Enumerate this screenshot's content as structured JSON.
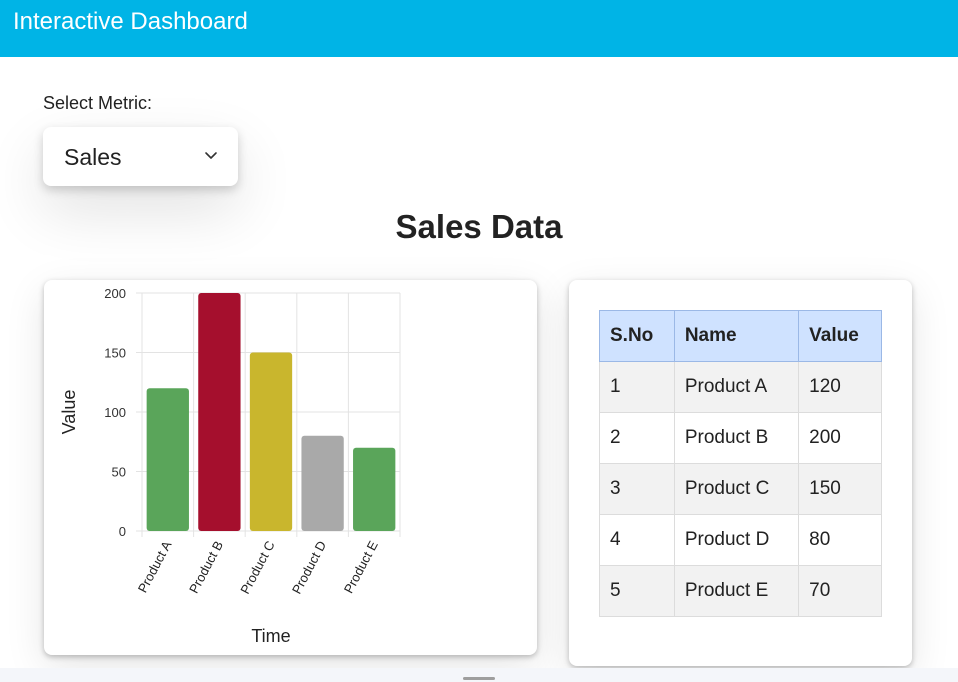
{
  "header": {
    "title": "Interactive Dashboard"
  },
  "selector": {
    "label": "Select Metric:",
    "value": "Sales",
    "icon": "chevron-down-icon"
  },
  "section": {
    "title": "Sales Data"
  },
  "chart_data": {
    "type": "bar",
    "categories": [
      "Product A",
      "Product B",
      "Product C",
      "Product D",
      "Product E"
    ],
    "values": [
      120,
      200,
      150,
      80,
      70
    ],
    "colors": [
      "#5aa55a",
      "#a50f2d",
      "#c9b62d",
      "#a9a9a9",
      "#5aa55a"
    ],
    "xlabel": "Time",
    "ylabel": "Value",
    "ylim": [
      0,
      200
    ],
    "yticks": [
      0,
      50,
      100,
      150,
      200
    ],
    "grid": true
  },
  "table": {
    "headers": [
      "S.No",
      "Name",
      "Value"
    ],
    "rows": [
      [
        "1",
        "Product A",
        "120"
      ],
      [
        "2",
        "Product B",
        "200"
      ],
      [
        "3",
        "Product C",
        "150"
      ],
      [
        "4",
        "Product D",
        "80"
      ],
      [
        "5",
        "Product E",
        "70"
      ]
    ],
    "header_color": "#cfe2ff"
  },
  "colors": {
    "header_bg": "#00b4e6"
  }
}
